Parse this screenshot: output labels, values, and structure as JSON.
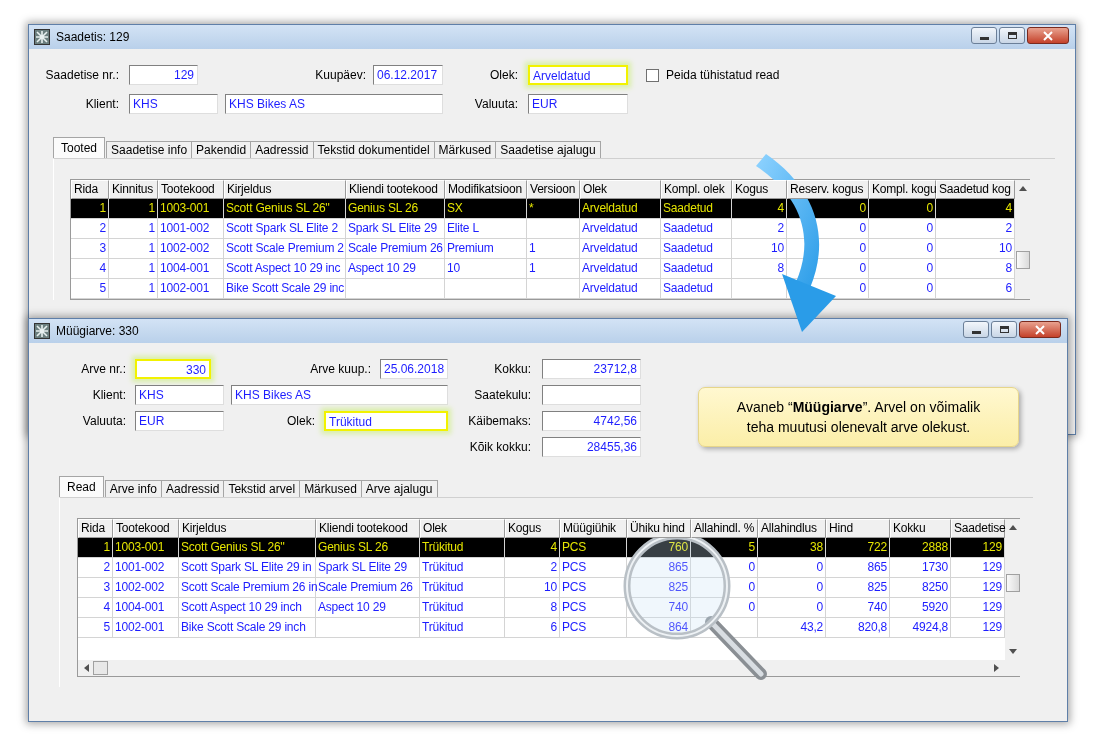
{
  "shipment_window": {
    "title": "Saadetis: 129",
    "fields": {
      "number": {
        "label": "Saadetise nr.:",
        "value": "129",
        "highlighted": false
      },
      "date": {
        "label": "Kuupäev:",
        "value": "06.12.2017",
        "highlighted": false
      },
      "status": {
        "label": "Olek:",
        "value": "Arveldatud",
        "highlighted": true
      },
      "client_code": {
        "label": "Klient:",
        "value": "KHS",
        "highlighted": false
      },
      "client_name": {
        "value": "KHS Bikes AS",
        "highlighted": false
      },
      "currency": {
        "label": "Valuuta:",
        "value": "EUR",
        "highlighted": false
      }
    },
    "hide_cancelled": {
      "label": "Peida tühistatud read",
      "checked": false
    },
    "tabs": [
      {
        "label": "Tooted",
        "selected": true
      },
      {
        "label": "Saadetise info",
        "selected": false
      },
      {
        "label": "Pakendid",
        "selected": false
      },
      {
        "label": "Aadressid",
        "selected": false
      },
      {
        "label": "Tekstid dokumentidel",
        "selected": false
      },
      {
        "label": "Märkused",
        "selected": false
      },
      {
        "label": "Saadetise ajalugu",
        "selected": false
      }
    ],
    "table": {
      "columns": [
        {
          "label": "Rida",
          "kind": "number"
        },
        {
          "label": "Kinnitus",
          "kind": "number"
        },
        {
          "label": "Tootekood",
          "kind": "text"
        },
        {
          "label": "Kirjeldus",
          "kind": "text"
        },
        {
          "label": "Kliendi tootekood",
          "kind": "text"
        },
        {
          "label": "Modifikatsioon",
          "kind": "text"
        },
        {
          "label": "Versioon",
          "kind": "text"
        },
        {
          "label": "Olek",
          "kind": "text"
        },
        {
          "label": "Kompl. olek",
          "kind": "text"
        },
        {
          "label": "Kogus",
          "kind": "number"
        },
        {
          "label": "Reserv. kogus",
          "kind": "number"
        },
        {
          "label": "Kompl. kogu",
          "kind": "number"
        },
        {
          "label": "Saadetud kog",
          "kind": "number"
        }
      ],
      "rows": [
        {
          "selected": true,
          "cells": [
            "1",
            "1",
            "1003-001",
            "Scott Genius SL 26''",
            "Genius SL 26",
            "SX",
            "*",
            "Arveldatud",
            "Saadetud",
            "4",
            "0",
            "0",
            "4"
          ]
        },
        {
          "selected": false,
          "cells": [
            "2",
            "1",
            "1001-002",
            "Scott Spark SL Elite 2",
            "Spark SL Elite 29",
            "Elite L",
            null,
            "Arveldatud",
            "Saadetud",
            "2",
            "0",
            "0",
            "2"
          ]
        },
        {
          "selected": false,
          "cells": [
            "3",
            "1",
            "1002-002",
            "Scott Scale Premium 2",
            "Scale Premium 26",
            "Premium",
            "1",
            "Arveldatud",
            "Saadetud",
            "10",
            "0",
            "0",
            "10"
          ]
        },
        {
          "selected": false,
          "cells": [
            "4",
            "1",
            "1004-001",
            "Scott Aspect 10 29 inc",
            "Aspect 10 29",
            "10",
            "1",
            "Arveldatud",
            "Saadetud",
            "8",
            "0",
            "0",
            "8"
          ]
        },
        {
          "selected": false,
          "cells": [
            "5",
            "1",
            "1002-001",
            "Bike Scott Scale 29 inc",
            null,
            null,
            null,
            "Arveldatud",
            "Saadetud",
            null,
            "0",
            "0",
            "6"
          ]
        }
      ]
    }
  },
  "invoice_window": {
    "title": "Müügiarve: 330",
    "fields": {
      "number": {
        "label": "Arve nr.:",
        "value": "330",
        "highlighted": true
      },
      "date": {
        "label": "Arve kuup.:",
        "value": "25.06.2018",
        "highlighted": false
      },
      "client_code": {
        "label": "Klient:",
        "value": "KHS",
        "highlighted": false
      },
      "client_name": {
        "value": "KHS Bikes AS",
        "highlighted": false
      },
      "currency": {
        "label": "Valuuta:",
        "value": "EUR",
        "highlighted": false
      },
      "status": {
        "label": "Olek:",
        "value": "Trükitud",
        "highlighted": true
      }
    },
    "totals": [
      {
        "label": "Kokku:",
        "value": "23712,8"
      },
      {
        "label": "Saatekulu:"
      },
      {
        "label": "Käibemaks:",
        "value": "4742,56"
      },
      {
        "label": "Kõik kokku:",
        "value": "28455,36"
      }
    ],
    "tabs": [
      {
        "label": "Read",
        "selected": true
      },
      {
        "label": "Arve info",
        "selected": false
      },
      {
        "label": "Aadressid",
        "selected": false
      },
      {
        "label": "Tekstid arvel",
        "selected": false
      },
      {
        "label": "Märkused",
        "selected": false
      },
      {
        "label": "Arve ajalugu",
        "selected": false
      }
    ],
    "table": {
      "columns": [
        {
          "label": "Rida",
          "kind": "number"
        },
        {
          "label": "Tootekood",
          "kind": "text"
        },
        {
          "label": "Kirjeldus",
          "kind": "text"
        },
        {
          "label": "Kliendi tootekood",
          "kind": "text"
        },
        {
          "label": "Olek",
          "kind": "text"
        },
        {
          "label": "Kogus",
          "kind": "number"
        },
        {
          "label": "Müügiühik",
          "kind": "text"
        },
        {
          "label": "Ühiku hind",
          "kind": "number"
        },
        {
          "label": "Allahindl. %",
          "kind": "number"
        },
        {
          "label": "Allahindlus",
          "kind": "number"
        },
        {
          "label": "Hind",
          "kind": "number"
        },
        {
          "label": "Kokku",
          "kind": "number"
        },
        {
          "label": "Saadetise",
          "kind": "number"
        }
      ],
      "rows": [
        {
          "selected": true,
          "cells": [
            "1",
            "1003-001",
            "Scott Genius SL 26''",
            "Genius SL 26",
            "Trükitud",
            "4",
            "PCS",
            "760",
            "5",
            "38",
            "722",
            "2888",
            "129"
          ]
        },
        {
          "selected": false,
          "cells": [
            "2",
            "1001-002",
            "Scott Spark SL Elite 29 in",
            "Spark SL Elite 29",
            "Trükitud",
            "2",
            "PCS",
            "865",
            "0",
            "0",
            "865",
            "1730",
            "129"
          ]
        },
        {
          "selected": false,
          "cells": [
            "3",
            "1002-002",
            "Scott Scale Premium 26 in",
            "Scale Premium 26",
            "Trükitud",
            "10",
            "PCS",
            "825",
            "0",
            "0",
            "825",
            "8250",
            "129"
          ]
        },
        {
          "selected": false,
          "cells": [
            "4",
            "1004-001",
            "Scott Aspect 10 29 inch",
            "Aspect 10 29",
            "Trükitud",
            "8",
            "PCS",
            "740",
            "0",
            "0",
            "740",
            "5920",
            "129"
          ]
        },
        {
          "selected": false,
          "cells": [
            "5",
            "1002-001",
            "Bike Scott Scale 29 inch",
            null,
            "Trükitud",
            "6",
            "PCS",
            "864",
            null,
            "43,2",
            "820,8",
            "4924,8",
            "129"
          ]
        }
      ]
    }
  },
  "callout": "Avaneb “**Müügiarve**”.  Arvel on võimalik teha muutusi olenevalt arve olekust."
}
